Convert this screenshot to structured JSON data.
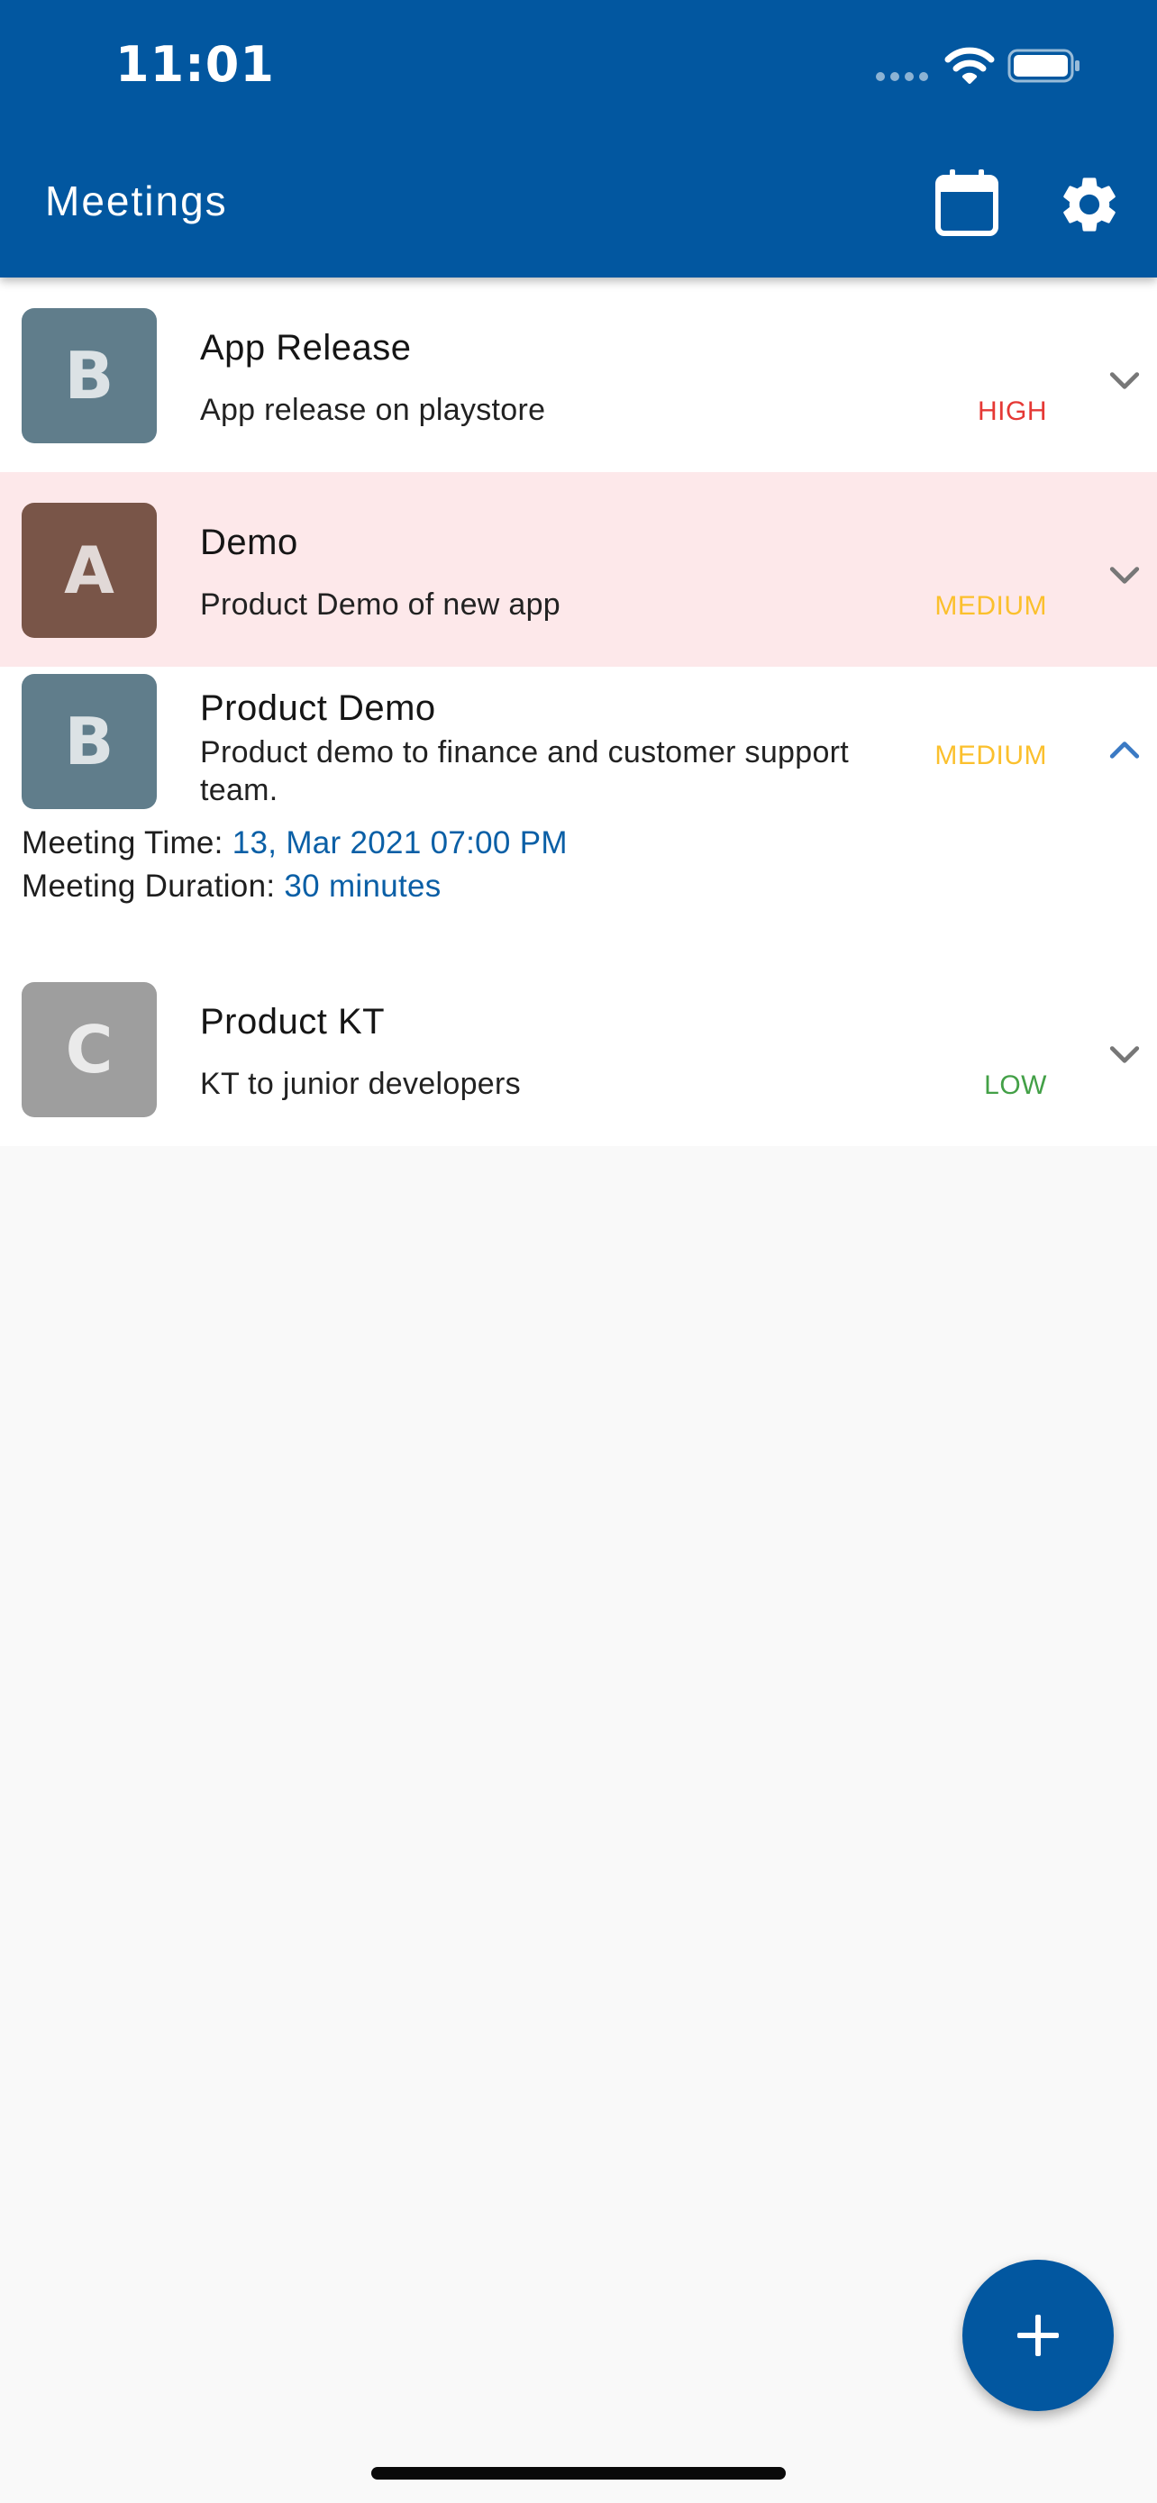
{
  "status_bar": {
    "time": "11:01",
    "icons": [
      "cellular-signal-icon",
      "wifi-icon",
      "battery-icon"
    ]
  },
  "header": {
    "title": "Meetings",
    "actions": [
      {
        "icon": "calendar-icon"
      },
      {
        "icon": "gear-icon"
      }
    ],
    "background": "#0257a0"
  },
  "meetings": [
    {
      "initial": "B",
      "title": "App Release",
      "description": "App release on playstore",
      "priority": "HIGH",
      "priority_color": "#e53935",
      "avatar_color": "#607d8b",
      "expanded": false,
      "highlighted": false
    },
    {
      "initial": "A",
      "title": "Demo",
      "description": "Product Demo of new app",
      "priority": "MEDIUM",
      "priority_color": "#fbc02d",
      "avatar_color": "#795548",
      "expanded": false,
      "highlighted": true,
      "highlight_color": "#fde8ea"
    },
    {
      "initial": "B",
      "title": "Product Demo",
      "description": "Product demo to finance and customer support team.",
      "priority": "MEDIUM",
      "priority_color": "#fbc02d",
      "avatar_color": "#607d8b",
      "expanded": true,
      "highlighted": false,
      "details": {
        "time_label": "Meeting Time:",
        "time_value": "13, Mar 2021 07:00 PM",
        "duration_label": "Meeting Duration:",
        "duration_value": "30 minutes"
      }
    },
    {
      "initial": "C",
      "title": "Product KT",
      "description": "KT to junior developers",
      "priority": "LOW",
      "priority_color": "#43a047",
      "avatar_color": "#9e9e9e",
      "expanded": false,
      "highlighted": false
    }
  ],
  "fab": {
    "icon": "plus-icon",
    "color": "#0257a0"
  },
  "colors": {
    "accent": "#0a5fa6",
    "chevron": "#777777",
    "chevron_expanded": "#3b7ac4"
  }
}
